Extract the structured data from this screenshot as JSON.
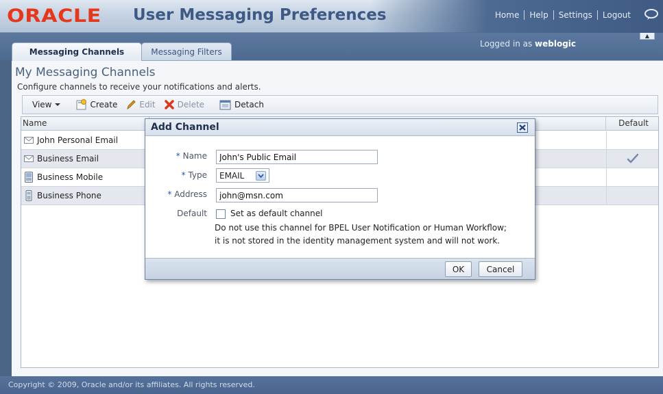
{
  "header": {
    "logo": "ORACLE",
    "title": "User Messaging Preferences",
    "links": [
      "Home",
      "Help",
      "Settings",
      "Logout"
    ],
    "logged_in_prefix": "Logged in as ",
    "logged_in_user": "weblogic"
  },
  "tabs": [
    {
      "label": "Messaging Channels",
      "active": true
    },
    {
      "label": "Messaging Filters",
      "active": false
    }
  ],
  "page": {
    "title": "My Messaging Channels",
    "description": "Configure channels to receive your notifications and alerts."
  },
  "toolbar": {
    "view": "View",
    "create": "Create",
    "edit": "Edit",
    "delete": "Delete",
    "detach": "Detach"
  },
  "table": {
    "columns": {
      "name": "Name",
      "default": "Default"
    },
    "rows": [
      {
        "name": "John Personal Email",
        "icon": "email-icon",
        "default": false
      },
      {
        "name": "Business Email",
        "icon": "email-icon",
        "default": true
      },
      {
        "name": "Business Mobile",
        "icon": "mobile-icon",
        "default": false
      },
      {
        "name": "Business Phone",
        "icon": "phone-icon",
        "default": false
      }
    ]
  },
  "dialog": {
    "title": "Add Channel",
    "fields": {
      "name_label": "Name",
      "name_value": "John's Public Email",
      "type_label": "Type",
      "type_value": "EMAIL",
      "address_label": "Address",
      "address_value": "john@msn.com",
      "default_label": "Default",
      "default_checkbox_label": "Set as default channel",
      "default_checked": false
    },
    "note_line1": "Do not use this channel for BPEL User Notification or Human Workflow;",
    "note_line2": "it is not stored in the identity management system and will not work.",
    "ok": "OK",
    "cancel": "Cancel"
  },
  "footer": {
    "copyright": "Copyright © 2009, Oracle and/or its affiliates. All rights reserved."
  },
  "colors": {
    "brand_red": "#e5371b",
    "header_blue": "#3e5a84",
    "required_marker": "#2257b0"
  }
}
